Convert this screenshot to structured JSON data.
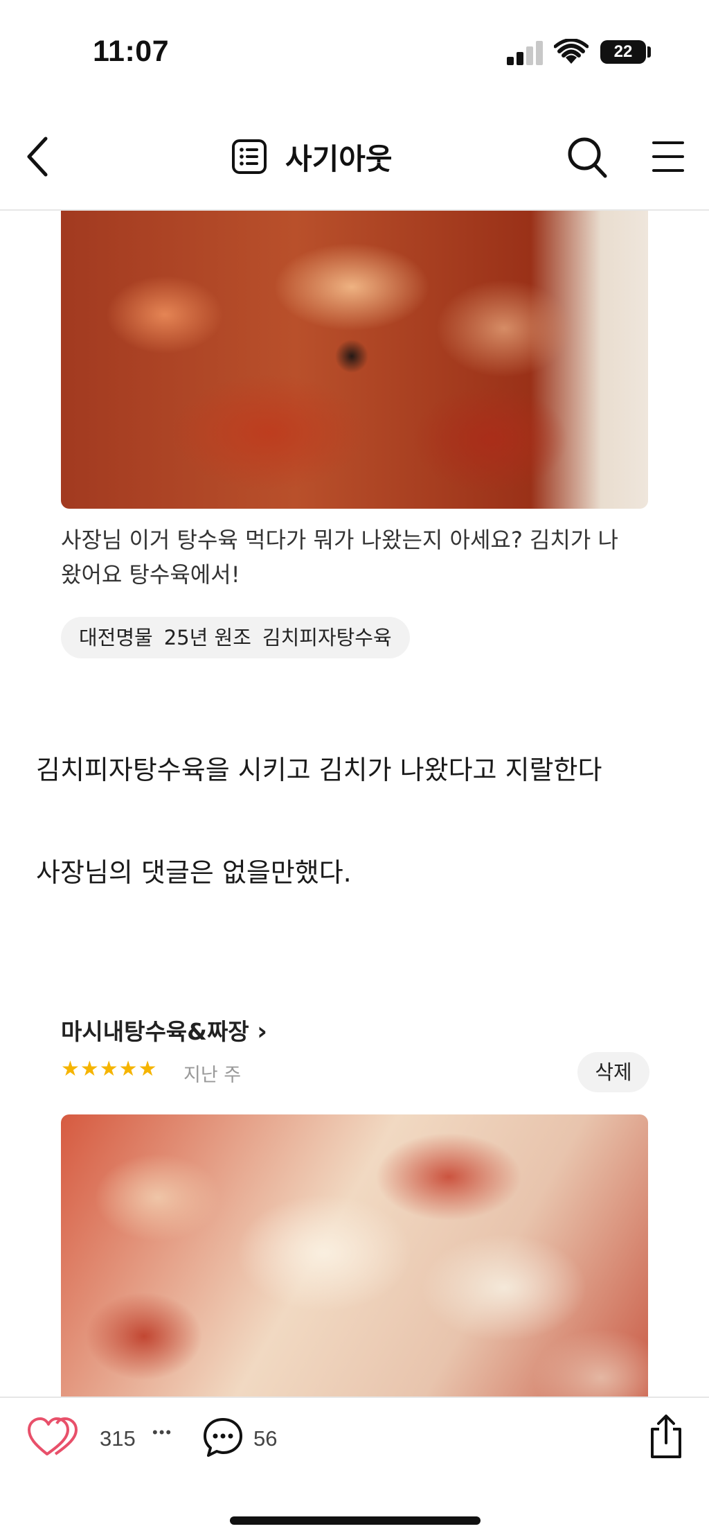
{
  "status_bar": {
    "time": "11:07",
    "battery": "22"
  },
  "nav": {
    "title": "사기아웃"
  },
  "post": {
    "caption": "사장님 이거 탕수육 먹다가 뭐가 나왔는지 아세요? 김치가 나왔어요  탕수육에서!",
    "tags": [
      "대전명물",
      "25년 원조",
      "김치피자탕수육"
    ],
    "paragraph_1": "김치피자탕수육을 시키고 김치가 나왔다고 지랄한다",
    "paragraph_2": "사장님의 댓글은 없을만했다.",
    "review": {
      "shop_name": "마시내탕수육&짜장",
      "chevron": "›",
      "stars": "★★★★★",
      "rating": 5,
      "date": "지난 주",
      "delete_label": "삭제"
    }
  },
  "bottom_bar": {
    "likes": "315",
    "more": "•••",
    "comments": "56"
  },
  "colors": {
    "star": "#f5b400",
    "heart": "#e8506a",
    "text": "#111111"
  },
  "icons": [
    "back-icon",
    "list-icon",
    "search-icon",
    "menu-icon",
    "heart-icon",
    "more-icon",
    "comment-icon",
    "share-icon"
  ]
}
